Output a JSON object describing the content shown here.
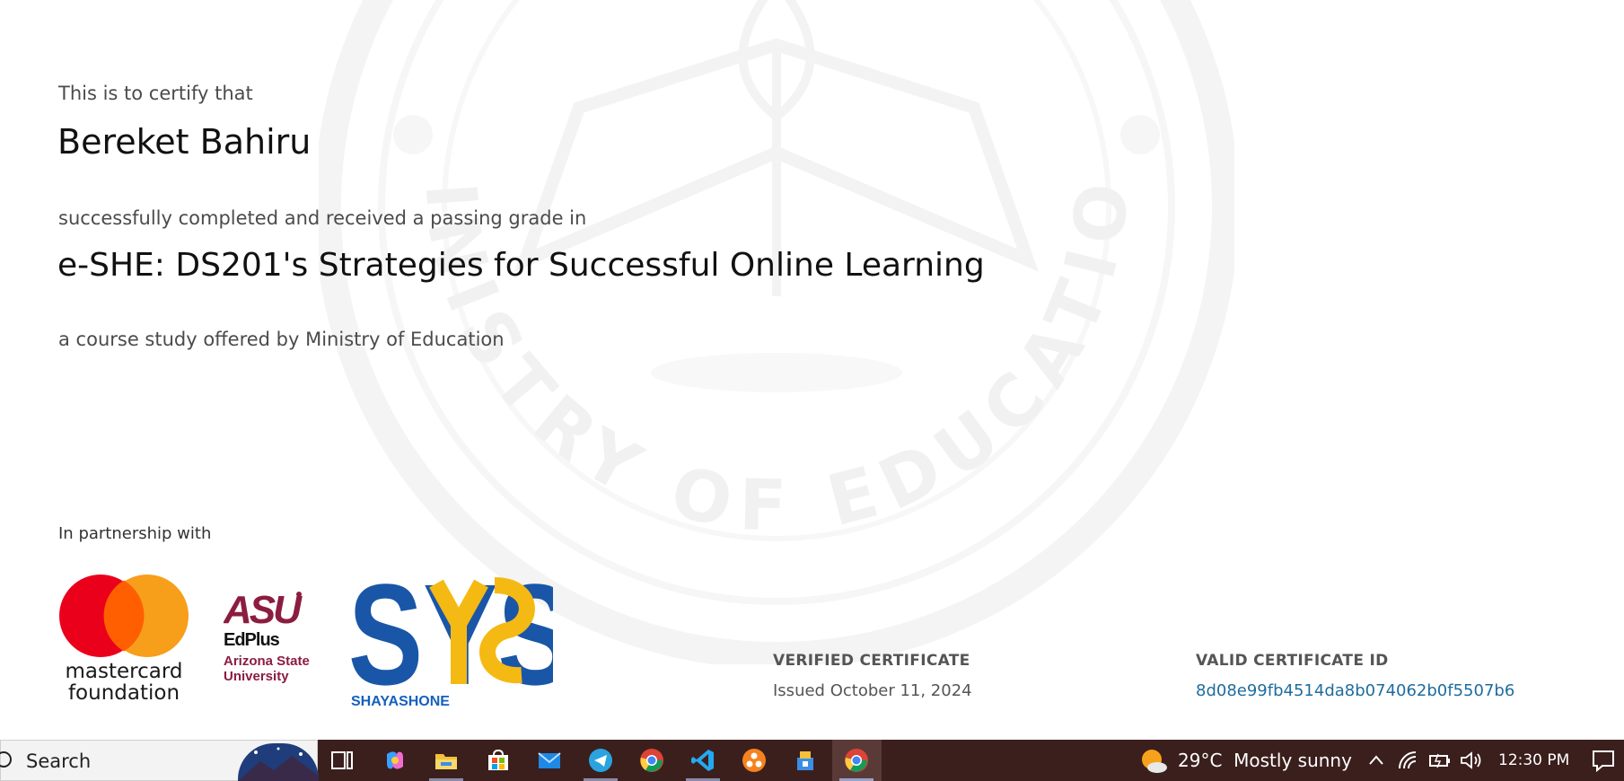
{
  "certificate": {
    "watermark_text": "MINISTRY OF EDUCATION",
    "certify_intro": "This is to certify that",
    "recipient_name": "Bereket Bahiru",
    "completion_text": "successfully completed and received a passing grade in",
    "course_title": "e-SHE: DS201's Strategies for Successful Online Learning",
    "offered_by": "a course study offered by Ministry of Education",
    "partnership_label": "In partnership with",
    "partners": {
      "mastercard": {
        "line1": "mastercard",
        "line2": "foundation"
      },
      "asu": {
        "mark": "ASU",
        "edplus": "EdPlus",
        "university_line1": "Arizona State",
        "university_line2": "University"
      },
      "shayashone": {
        "mark": "SYS",
        "label": "SHAYASHONE"
      }
    },
    "verified_heading": "VERIFIED CERTIFICATE",
    "issued_text": "Issued October 11, 2024",
    "id_heading": "VALID CERTIFICATE ID",
    "certificate_id": "8d08e99fb4514da8b074062b0f5507b6"
  },
  "taskbar": {
    "search_label": "Search",
    "apps": [
      "task-view",
      "copilot",
      "file-explorer",
      "microsoft-store",
      "mail",
      "telegram",
      "chrome",
      "vscode",
      "app-orange",
      "app-tool",
      "chrome-active"
    ],
    "weather": {
      "temp": "29°C",
      "condition": "Mostly sunny"
    },
    "clock": "12:30 PM"
  },
  "colors": {
    "taskbar_bg": "#3b1f1d",
    "link": "#1f6c9e",
    "mastercard_red": "#eb001b",
    "mastercard_orange": "#f79e1b",
    "asu_maroon": "#8c1d40",
    "sys_blue": "#1a56a8",
    "sys_yellow": "#f5b914"
  }
}
